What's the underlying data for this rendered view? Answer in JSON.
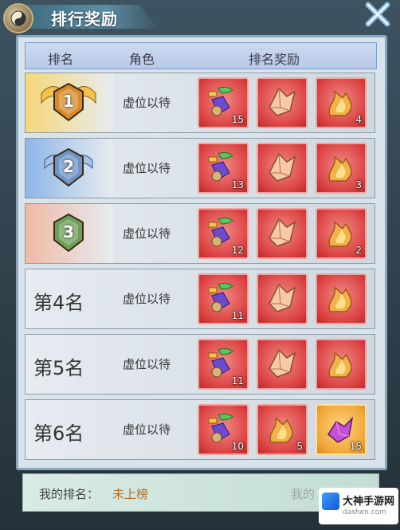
{
  "window": {
    "title": "排行奖励"
  },
  "table": {
    "headers": [
      "排名",
      "角色",
      "排名奖励"
    ],
    "rows": [
      {
        "rank_label": "",
        "rank_badge": "1",
        "role": "虚位以待",
        "rewards": [
          {
            "icon": "gift-pack-icon",
            "count": "15"
          },
          {
            "icon": "crystal-icon",
            "count": ""
          },
          {
            "icon": "flame-icon",
            "count": "4"
          }
        ]
      },
      {
        "rank_label": "",
        "rank_badge": "2",
        "role": "虚位以待",
        "rewards": [
          {
            "icon": "gift-pack-icon",
            "count": "13"
          },
          {
            "icon": "crystal-icon",
            "count": ""
          },
          {
            "icon": "flame-icon",
            "count": "3"
          }
        ]
      },
      {
        "rank_label": "",
        "rank_badge": "3",
        "role": "虚位以待",
        "rewards": [
          {
            "icon": "gift-pack-icon",
            "count": "12"
          },
          {
            "icon": "crystal-icon",
            "count": ""
          },
          {
            "icon": "flame-icon",
            "count": "2"
          }
        ]
      },
      {
        "rank_label": "第4名",
        "rank_badge": "",
        "role": "虚位以待",
        "rewards": [
          {
            "icon": "gift-pack-icon",
            "count": "11"
          },
          {
            "icon": "crystal-icon",
            "count": ""
          },
          {
            "icon": "flame-icon",
            "count": ""
          }
        ]
      },
      {
        "rank_label": "第5名",
        "rank_badge": "",
        "role": "虚位以待",
        "rewards": [
          {
            "icon": "gift-pack-icon",
            "count": "11"
          },
          {
            "icon": "crystal-icon",
            "count": ""
          },
          {
            "icon": "flame-icon",
            "count": ""
          }
        ]
      },
      {
        "rank_label": "第6名",
        "rank_badge": "",
        "role": "虚位以待",
        "rewards": [
          {
            "icon": "gift-pack-icon",
            "count": "10"
          },
          {
            "icon": "flame-icon",
            "count": "5"
          },
          {
            "icon": "purple-gem-icon",
            "count": "15"
          }
        ]
      }
    ]
  },
  "my_rank": {
    "label": "我的排名：",
    "value": "未上榜",
    "right_text": "我的"
  },
  "watermark": {
    "line1": "大神手游网",
    "line2": "dashen.com"
  },
  "colors": {
    "badge_gold": "#d88a2a",
    "badge_silver": "#6f95c8",
    "badge_bronze": "#6e9f5a"
  }
}
